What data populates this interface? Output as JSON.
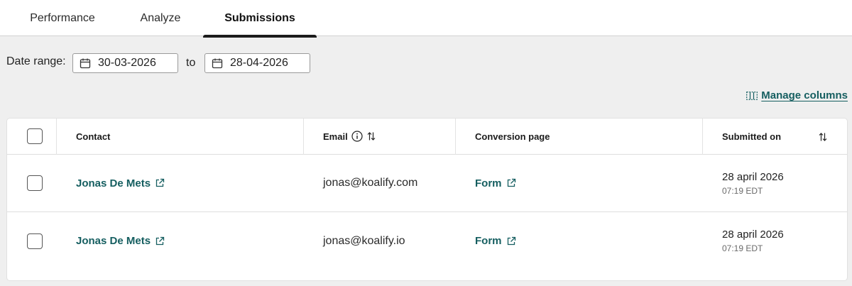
{
  "tabs": [
    {
      "label": "Performance"
    },
    {
      "label": "Analyze"
    },
    {
      "label": "Submissions"
    }
  ],
  "filters": {
    "date_range_label": "Date range:",
    "from": "30-03-2026",
    "to_label": "to",
    "to": "28-04-2026"
  },
  "manage_columns": {
    "label": "Manage columns"
  },
  "table": {
    "columns": {
      "contact": "Contact",
      "email": "Email",
      "conversion_page": "Conversion page",
      "submitted_on": "Submitted on"
    },
    "rows": [
      {
        "contact": "Jonas De Mets",
        "email": "jonas@koalify.com",
        "conversion_page": "Form",
        "date": "28 april 2026",
        "time": "07:19 EDT"
      },
      {
        "contact": "Jonas De Mets",
        "email": "jonas@koalify.io",
        "conversion_page": "Form",
        "date": "28 april 2026",
        "time": "07:19 EDT"
      }
    ]
  },
  "colors": {
    "accent": "#155e60",
    "background": "#efefef",
    "active_tab_indicator": "#1b1b1b"
  },
  "icons": [
    "calendar-icon",
    "manage-columns-icon",
    "info-icon",
    "sort-icon",
    "external-link-icon"
  ]
}
